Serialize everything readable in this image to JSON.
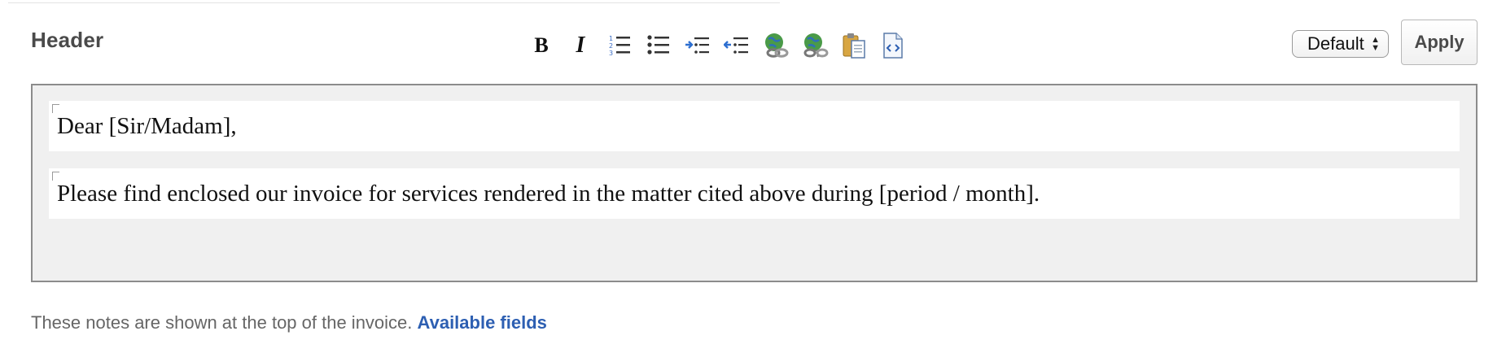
{
  "section": {
    "title": "Header"
  },
  "toolbar": {
    "bold_label": "B",
    "italic_label": "I",
    "icons": [
      "bold-icon",
      "italic-icon",
      "ordered-list-icon",
      "unordered-list-icon",
      "indent-icon",
      "outdent-icon",
      "insert-link-icon",
      "remove-link-icon",
      "paste-icon",
      "html-source-icon"
    ]
  },
  "style_select": {
    "selected": "Default"
  },
  "apply_button": {
    "label": "Apply"
  },
  "editor": {
    "paragraphs": [
      "Dear [Sir/Madam],",
      "Please find enclosed our invoice for services rendered in the matter cited above during [period / month]."
    ]
  },
  "help": {
    "text": "These notes are shown at the top of the invoice.",
    "link_label": "Available fields"
  },
  "colors": {
    "link": "#2d5fb2",
    "editor_bg": "#f0f0f0",
    "title_text": "#4a4a4a"
  }
}
